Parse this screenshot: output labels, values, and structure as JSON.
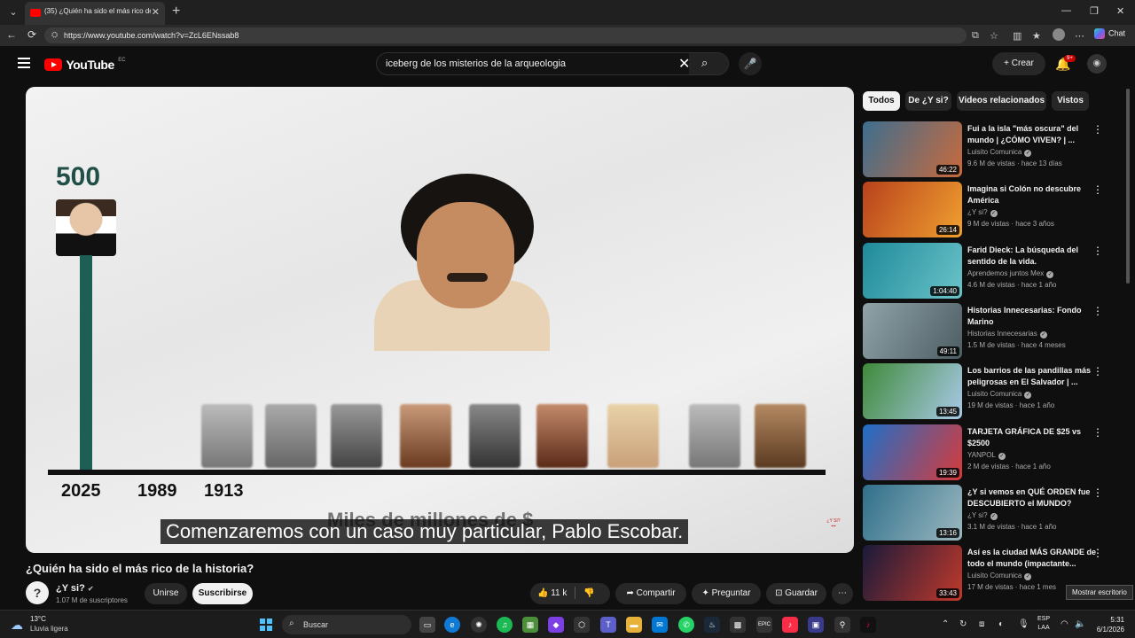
{
  "browser": {
    "tab_title": "(35) ¿Quién ha sido el más rico de",
    "url": "https://www.youtube.com/watch?v=ZcL6ENssab8",
    "chat_label": "Chat"
  },
  "header": {
    "logo": "YouTube",
    "country": "EC",
    "search_query": "iceberg de los misterios de la arqueologia",
    "create_label": "Crear",
    "notif_count": "9+"
  },
  "video": {
    "counter": "500",
    "years": [
      "2025",
      "1989",
      "1913"
    ],
    "axis_ghost": "Miles de millones de $",
    "subtitle": "Comenzaremos con un caso muy particular, Pablo Escobar.",
    "title": "¿Quién ha sido el más rico de la historia?"
  },
  "channel": {
    "name": "¿Y si?",
    "subscribers": "1.07 M de suscriptores",
    "join_label": "Unirse",
    "subscribe_label": "Suscribirse"
  },
  "actions": {
    "likes": "11 k",
    "share": "Compartir",
    "ask": "Preguntar",
    "save": "Guardar"
  },
  "chips": [
    "Todos",
    "De ¿Y si?",
    "Videos relacionados",
    "Vistos"
  ],
  "recommendations": [
    {
      "title": "Fui a la isla \"más oscura\" del mundo | ¿CÓMO VIVEN? | ...",
      "channel": "Luisito Comunica",
      "meta": "9.6 M de vistas · hace 13 días",
      "duration": "46:22",
      "c1": "#3d6e8f",
      "c2": "#c96a3c"
    },
    {
      "title": "Imagina si Colón no descubre América",
      "channel": "¿Y si?",
      "meta": "9 M de vistas · hace 3 años",
      "duration": "26:14",
      "c1": "#b8421c",
      "c2": "#f0a030"
    },
    {
      "title": "Farid Dieck: La búsqueda del sentido de la vida.",
      "channel": "Aprendemos juntos Mex",
      "meta": "4.6 M de vistas · hace 1 año",
      "duration": "1:04:40",
      "c1": "#1f8a9a",
      "c2": "#6bc3c9"
    },
    {
      "title": "Historias Innecesarias: Fondo Marino",
      "channel": "Historias Innecesarias",
      "meta": "1.5 M de vistas · hace 4 meses",
      "duration": "49:11",
      "c1": "#8fa3a8",
      "c2": "#4d5e63"
    },
    {
      "title": "Los barrios de las pandillas más peligrosas en El Salvador | ...",
      "channel": "Luisito Comunica",
      "meta": "19 M de vistas · hace 1 año",
      "duration": "13:45",
      "c1": "#3f8a3a",
      "c2": "#a9c9e8"
    },
    {
      "title": "TARJETA GRÁFICA DE $25 vs $2500",
      "channel": "YANPOL",
      "meta": "2 M de vistas · hace 1 año",
      "duration": "19:39",
      "c1": "#1e6fc9",
      "c2": "#d83a3a"
    },
    {
      "title": "¿Y si vemos en QUÉ ORDEN fue DESCUBIERTO el MUNDO?",
      "channel": "¿Y si?",
      "meta": "3.1 M de vistas · hace 1 año",
      "duration": "13:16",
      "c1": "#2f6f8a",
      "c2": "#9bb8c0"
    },
    {
      "title": "Así es la ciudad MÁS GRANDE de todo el mundo (impactante...",
      "channel": "Luisito Comunica",
      "meta": "17 M de vistas · hace 1 mes",
      "duration": "33:43",
      "c1": "#1a1a3a",
      "c2": "#c0392b"
    }
  ],
  "tooltip": "Mostrar escritorio",
  "taskbar": {
    "temp": "13°C",
    "weather": "Lluvia ligera",
    "search_label": "Buscar",
    "lang1": "ESP",
    "lang2": "LAA",
    "time": "5:31",
    "date": "6/1/2026"
  }
}
